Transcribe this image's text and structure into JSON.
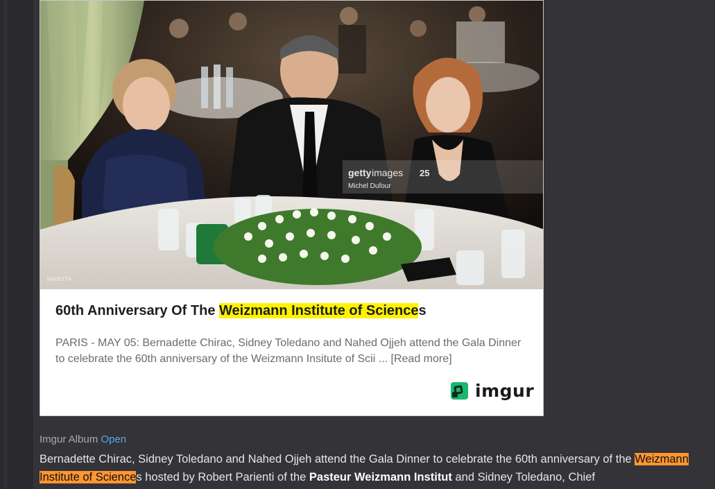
{
  "card": {
    "photo": {
      "alt": "Bernadette Chirac, Sidney Toledano and Nahed Ojjeh at the Gala Dinner table",
      "watermark_brand": "gettyimages",
      "watermark_badge": "25",
      "watermark_credit": "Michel Dufour",
      "image_id": "86435774"
    },
    "title_prefix": "60th Anniversary Of The ",
    "title_highlight": "Weizmann Institute of Science",
    "title_suffix": "s",
    "description": "PARIS - MAY 05: Bernadette Chirac, Sidney Toledano and Nahed Ojjeh attend the Gala Dinner to celebrate the 60th anniversary of the Weizmann Insitute of Sciі",
    "read_more": "... [Read more]",
    "brand": "imgur"
  },
  "meta": {
    "label": "Imgur Album",
    "open_link": "Open"
  },
  "body": {
    "part1": "Bernadette Chirac, Sidney Toledano and Nahed Ojjeh attend the Gala Dinner to celebrate the 60th anniversary of the ",
    "highlight": "Weizmann Institute of Science",
    "part2": "s hosted by Robert Parienti of the ",
    "bold1": "Pasteur Weizmann Institut",
    "part3": " and Sidney Toledano, Chief"
  },
  "colors": {
    "background": "#333338",
    "card": "#ffffff",
    "highlight_yellow": "#fff200",
    "highlight_orange": "#ff9632",
    "link": "#5aa9e6",
    "imgur_green": "#1bb76e"
  },
  "icons": [
    "imgur-logo-icon"
  ]
}
